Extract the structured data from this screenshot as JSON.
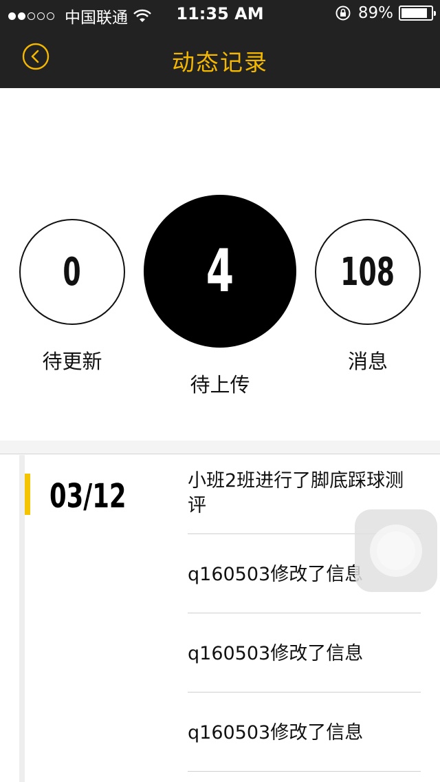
{
  "status_bar": {
    "carrier": "中国联通",
    "time": "11:35 AM",
    "battery_percent": "89%",
    "battery_level": 0.89,
    "signal_bars_filled": 2,
    "signal_bars_total": 5
  },
  "nav": {
    "title": "动态记录",
    "back_icon": "chevron-left-circle-icon"
  },
  "colors": {
    "nav_bg": "#222222",
    "accent": "#f5b800",
    "highlight_bar": "#f5c400"
  },
  "stats": [
    {
      "value": "0",
      "label": "待更新"
    },
    {
      "value": "4",
      "label": "待上传"
    },
    {
      "value": "108",
      "label": "消息"
    }
  ],
  "timeline": {
    "date": "03/12",
    "events": [
      "小班2班进行了脚底踩球测评",
      "q160503修改了信息",
      "q160503修改了信息",
      "q160503修改了信息"
    ]
  }
}
